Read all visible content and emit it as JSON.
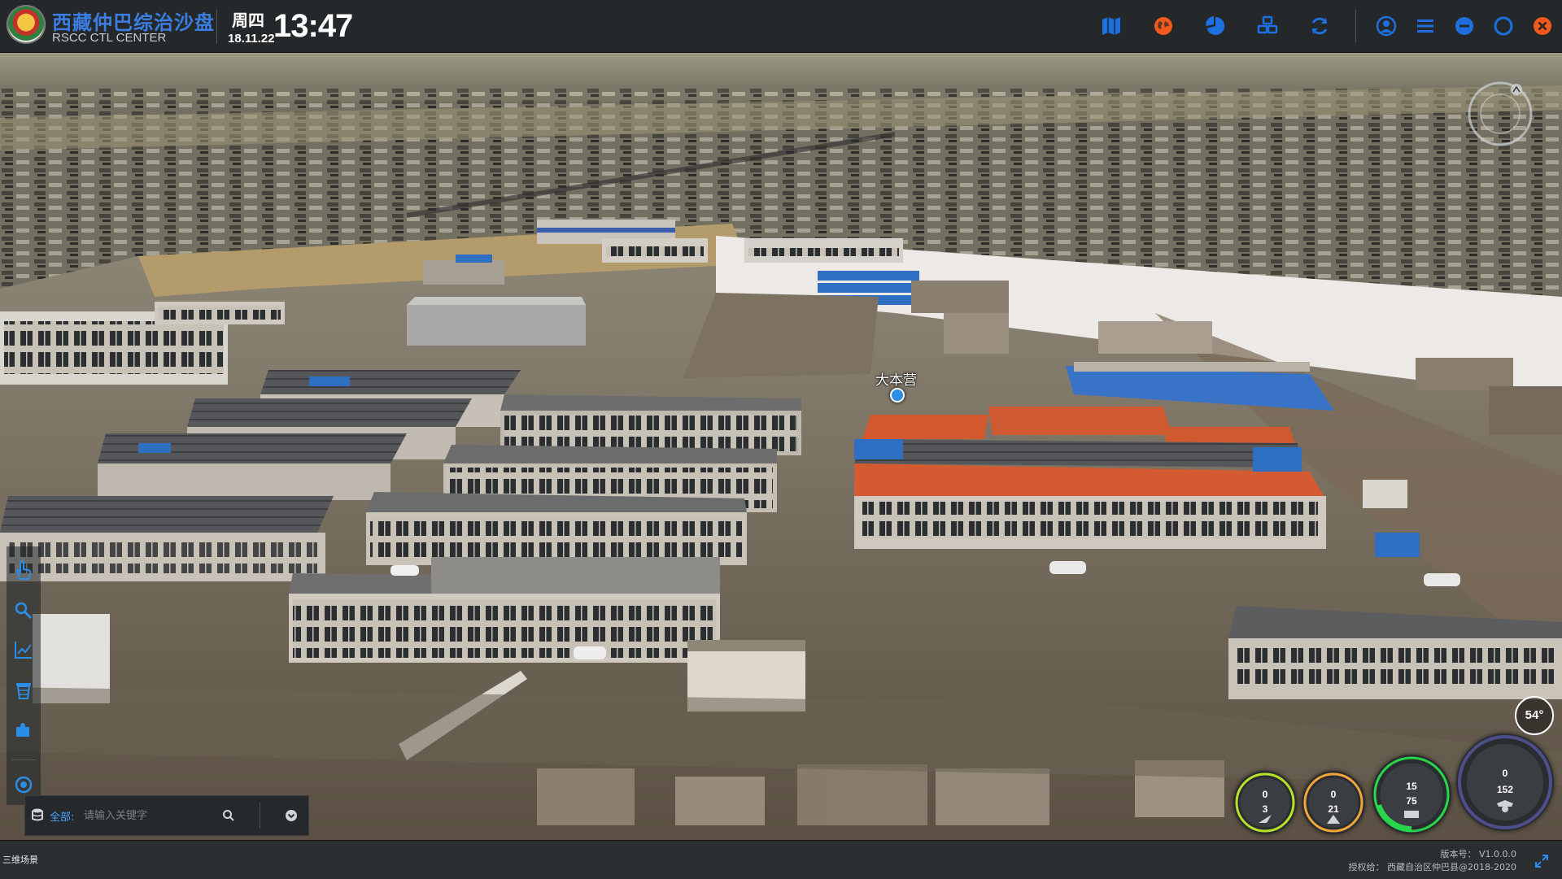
{
  "header": {
    "title": "西藏仲巴综治沙盘",
    "subtitle": "RSCC CTL CENTER",
    "weekday": "周四",
    "date": "18.11.22",
    "time": "13:47",
    "icons": [
      "map-icon",
      "globe-icon",
      "pie-chart-icon",
      "layers-icon",
      "refresh-icon",
      "user-icon",
      "menu-icon",
      "minimize-icon",
      "maximize-icon",
      "close-icon"
    ],
    "accent": "#3c7ee0",
    "icon_color": "#1e6fe0",
    "icon_alt_color": "#f25a1d"
  },
  "scene": {
    "place_label": "大本营",
    "view_angle": "54°"
  },
  "left_toolbar": {
    "items": [
      "hand-icon",
      "search-zoom-icon",
      "chart-icon",
      "trash-icon",
      "puzzle-icon",
      "target-icon"
    ]
  },
  "search": {
    "scope_label": "全部:",
    "placeholder": "请输入关键字"
  },
  "gauges": [
    {
      "name": "gauge-1",
      "top": "0",
      "bottom": "3",
      "ring": "#b7e22a"
    },
    {
      "name": "gauge-2",
      "top": "0",
      "bottom": "21",
      "ring": "#f2a53a"
    },
    {
      "name": "gauge-3",
      "top": "15",
      "bottom": "75",
      "ring": "#29d64b",
      "progress": 0.2
    },
    {
      "name": "gauge-4",
      "top": "0",
      "bottom": "152",
      "ring": "#4e4f8a"
    }
  ],
  "status": {
    "scene_mode": "三维场景",
    "version": "版本号：  V1.0.0.0",
    "license": "授权给：  西藏自治区仲巴县@2018-2020"
  }
}
